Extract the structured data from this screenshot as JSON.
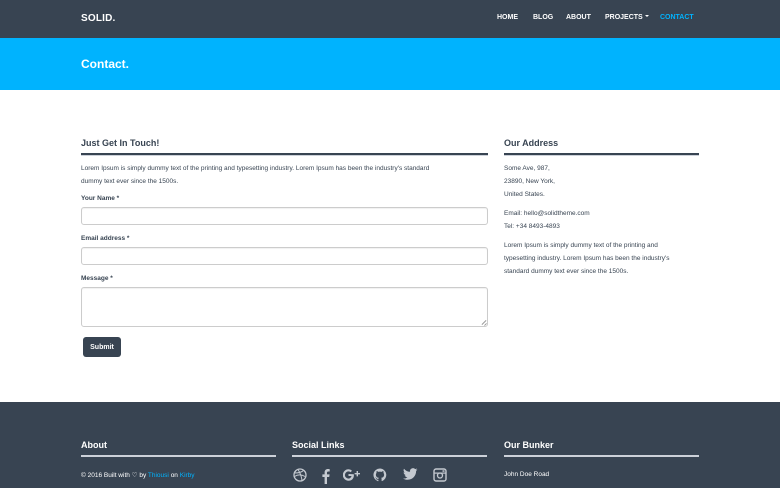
{
  "navbar": {
    "brand": "SOLID.",
    "items": [
      "HOME",
      "BLOG",
      "ABOUT",
      "PROJECTS",
      "CONTACT"
    ]
  },
  "banner": {
    "title": "Contact."
  },
  "contact": {
    "title": "Just Get In Touch!",
    "intro_line1": "Lorem Ipsum is simply dummy text of the printing and typesetting industry. Lorem Ipsum has been the industry's standard",
    "intro_line2": "dummy text ever since the 1500s.",
    "name_label": "Your Name *",
    "name_value": "",
    "email_label": "Email address *",
    "email_value": "",
    "message_label": "Message *",
    "message_value": "",
    "submit_label": "Submit"
  },
  "address": {
    "title": "Our Address",
    "line1": "Some Ave, 987,",
    "line2": "23890, New York,",
    "line3": "United States.",
    "email": "Email: hello@solidtheme.com",
    "tel": "Tel: +34 8493-4893",
    "desc_line1": "Lorem Ipsum is simply dummy text of the printing and",
    "desc_line2": "typesetting industry. Lorem Ipsum has been the industry's",
    "desc_line3": "standard dummy text ever since the 1500s."
  },
  "footer": {
    "about_title": "About",
    "about_prefix": "© 2016 Built with",
    "about_heart": "♡",
    "about_by": "by",
    "about_author": "Thiousi",
    "about_on": "on",
    "about_kirby": "Kirby",
    "social_title": "Social Links",
    "social_icons": [
      "dribbble-icon",
      "facebook-icon",
      "google-plus-icon",
      "github-icon",
      "twitter-icon",
      "instagram-icon"
    ],
    "bunker_title": "Our Bunker",
    "bunker_line1": "John Doe Road"
  },
  "colors": {
    "navy": "#384452",
    "accent": "#00b3fe",
    "white": "#ffffff",
    "rule_light": "#ccd1d9"
  }
}
